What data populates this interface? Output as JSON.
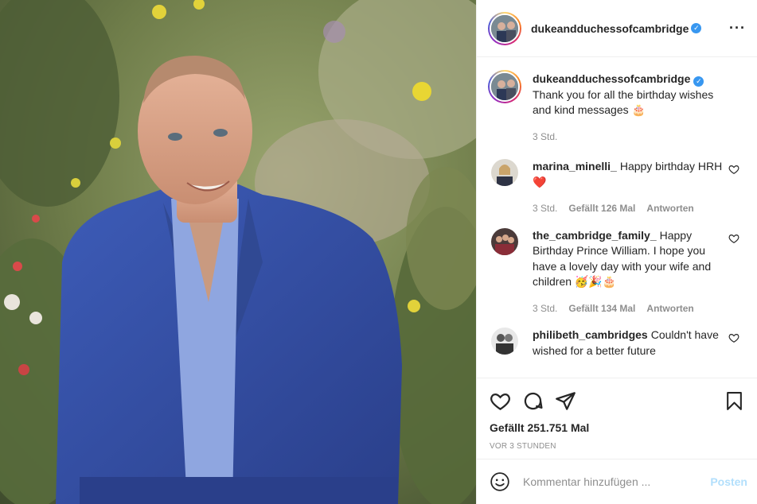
{
  "post": {
    "author": "dukeandduchessofcambridge",
    "verified": true,
    "caption": "Thank you for all the birthday wishes and kind messages",
    "caption_emoji": "🎂",
    "caption_time": "3 Std."
  },
  "comments": [
    {
      "user": "marina_minelli_",
      "text": "Happy birthday HRH",
      "emoji": "❤️",
      "time": "3 Std.",
      "likes": "Gefällt 126 Mal",
      "reply": "Antworten"
    },
    {
      "user": "the_cambridge_family_",
      "text": "Happy Birthday Prince William. I hope you have a lovely day with your wife and children",
      "emoji": "🥳🎉🎂",
      "time": "3 Std.",
      "likes": "Gefällt 134 Mal",
      "reply": "Antworten"
    },
    {
      "user": "philibeth_cambridges",
      "text": "Couldn't have wished for a better future"
    }
  ],
  "actions": {
    "likes": "Gefällt 251.751 Mal",
    "timestamp": "VOR 3 STUNDEN"
  },
  "comment_box": {
    "placeholder": "Kommentar hinzufügen ...",
    "post_label": "Posten"
  },
  "icons": {
    "header_more": "more-options-icon",
    "like": "heart-icon",
    "comment": "comment-icon",
    "share": "paper-plane-icon",
    "save": "bookmark-icon",
    "emoji": "smiley-icon"
  },
  "colors": {
    "verified_blue": "#3897f0",
    "post_button_disabled": "#b2dffc",
    "secondary_text": "#8e8e8e"
  }
}
